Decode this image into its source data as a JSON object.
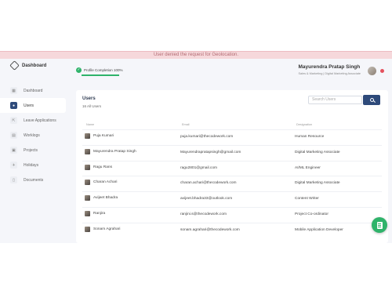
{
  "banner": {
    "text": "User denied the request for Geolocation."
  },
  "sidebar": {
    "brand": "Dashboard",
    "items": [
      {
        "label": "Dashboard",
        "icon": "grid-icon"
      },
      {
        "label": "Users",
        "icon": "users-icon",
        "active": true
      },
      {
        "label": "Leave Applications",
        "icon": "leave-icon"
      },
      {
        "label": "Worklogs",
        "icon": "worklog-icon"
      },
      {
        "label": "Projects",
        "icon": "projects-icon"
      },
      {
        "label": "Holidays",
        "icon": "holiday-icon"
      },
      {
        "label": "Documents",
        "icon": "document-icon"
      }
    ]
  },
  "header": {
    "profile_label": "Profile Completion  100%",
    "profile_progress": 1.0,
    "user_name": "Mayurendra Pratap Singh",
    "user_role": "Sales & Marketing | Digital Marketing Associate"
  },
  "users": {
    "title": "Users",
    "count": "16 All Users",
    "search_placeholder": "Search Users",
    "columns": {
      "name": "Name",
      "email": "Email",
      "designation": "Designation"
    },
    "rows": [
      {
        "name": "Puja Kumari",
        "email": "puja.kumari@thecodework.com",
        "designation": "Human Resource"
      },
      {
        "name": "Mayurendra Pratap Singh",
        "email": "Mayurendrapratapsingh@gmail.com",
        "designation": "Digital Marketing Associate"
      },
      {
        "name": "Ragu Rans",
        "email": "ragu2801@gmail.com",
        "designation": "AI/ML Engineer"
      },
      {
        "name": "Charan Achari",
        "email": "charan.achari@thecodework.com",
        "designation": "Digital Marketing Associate"
      },
      {
        "name": "Avijeet Bhadra",
        "email": "avijeet.bhadra33@outlook.com",
        "designation": "Content Writer"
      },
      {
        "name": "Ranjira",
        "email": "ranjini.s@thecodework.com",
        "designation": "Project Co-ordinator"
      },
      {
        "name": "Sonam Agrahari",
        "email": "sonam.agrahari@thecodework.com",
        "designation": "Mobile Application Developer"
      }
    ]
  },
  "colors": {
    "accent": "#2e4a7a",
    "success": "#2fb36a",
    "banner_bg": "#f6d8db"
  }
}
